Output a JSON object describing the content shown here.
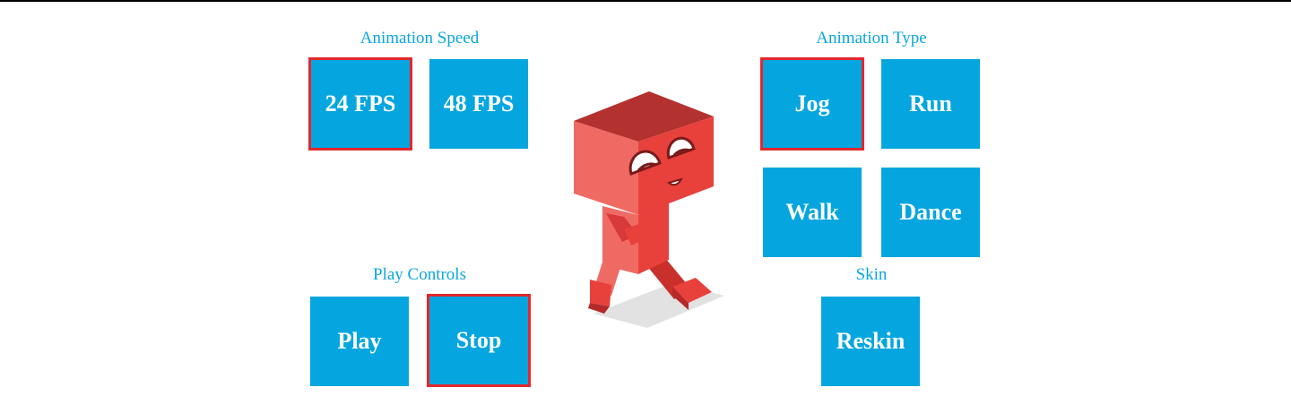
{
  "speed": {
    "label": "Animation Speed",
    "buttons": [
      "24 FPS",
      "48 FPS"
    ],
    "selected": "24 FPS"
  },
  "type": {
    "label": "Animation Type",
    "buttons": [
      "Jog",
      "Run",
      "Walk",
      "Dance"
    ],
    "selected": "Jog"
  },
  "controls": {
    "label": "Play Controls",
    "buttons": [
      "Play",
      "Stop"
    ],
    "selected": "Stop"
  },
  "skin": {
    "label": "Skin",
    "buttons": [
      "Reskin"
    ]
  },
  "colors": {
    "button": "#05a6df",
    "selected_border": "#e4272d",
    "label": "#0aa6dc",
    "character": "#e8413c"
  }
}
